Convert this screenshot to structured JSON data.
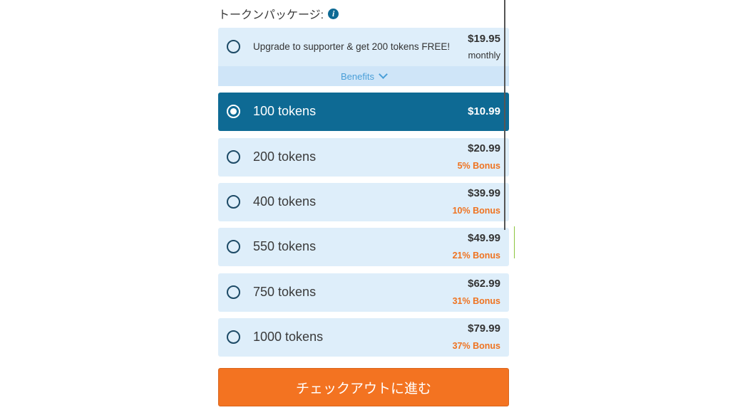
{
  "heading": "トークンパッケージ:",
  "info_icon": "info-icon",
  "supporter": {
    "text": "Upgrade to supporter & get 200 tokens FREE!",
    "price": "$19.95",
    "period": "monthly",
    "benefits_label": "Benefits"
  },
  "packages": [
    {
      "label": "100 tokens",
      "price": "$10.99",
      "bonus": "",
      "selected": true
    },
    {
      "label": "200 tokens",
      "price": "$20.99",
      "bonus": "5% Bonus",
      "selected": false
    },
    {
      "label": "400 tokens",
      "price": "$39.99",
      "bonus": "10% Bonus",
      "selected": false
    },
    {
      "label": "550 tokens",
      "price": "$49.99",
      "bonus": "21% Bonus",
      "selected": false
    },
    {
      "label": "750 tokens",
      "price": "$62.99",
      "bonus": "31% Bonus",
      "selected": false
    },
    {
      "label": "1000 tokens",
      "price": "$79.99",
      "bonus": "37% Bonus",
      "selected": false
    }
  ],
  "checkout_label": "チェックアウトに進む",
  "colors": {
    "selected_bg": "#0e6a94",
    "option_bg": "#deeefa",
    "bonus": "#ef7320",
    "checkout_bg": "#f37321"
  }
}
